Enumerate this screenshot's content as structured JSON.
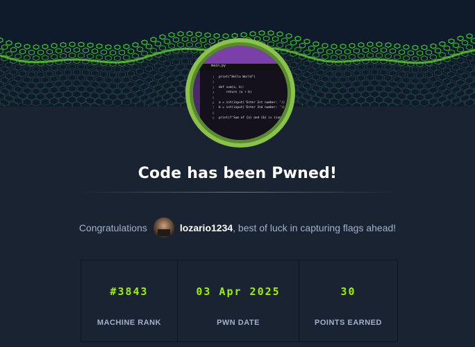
{
  "header": {
    "title": "Code has been Pwned!"
  },
  "badge": {
    "icon": "code-editor-machine-avatar",
    "editor_tab": "main.py",
    "code_lines": [
      "print(\"Hello World\")",
      "",
      "def sum(a, b):",
      "    return (a + b)",
      "",
      "a = int(input('Enter 1st number: '))",
      "b = int(input('Enter 2nd number: '))",
      "",
      "print(f'Sum of {a} and {b} is {sum(a,"
    ]
  },
  "congrats": {
    "prefix": "Congratulations",
    "username": "lozario1234",
    "suffix": ", best of luck in capturing flags ahead!"
  },
  "stats": [
    {
      "value": "#3843",
      "label": "MACHINE RANK"
    },
    {
      "value": "03 Apr 2025",
      "label": "PWN DATE"
    },
    {
      "value": "30",
      "label": "POINTS EARNED"
    }
  ],
  "colors": {
    "background": "#1a2332",
    "accent": "#9fef00",
    "ring": "#8bc34a",
    "muted_text": "#a4b1cd"
  }
}
